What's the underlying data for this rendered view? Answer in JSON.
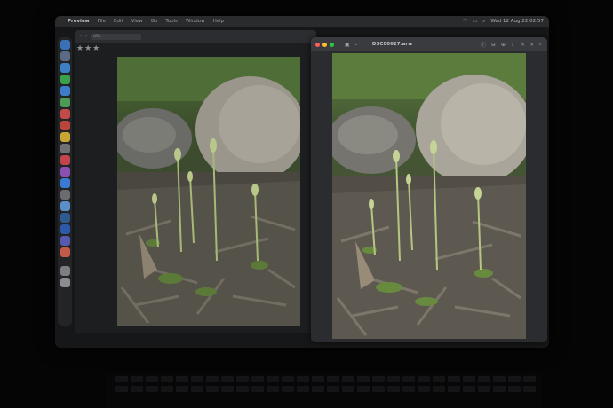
{
  "menubar": {
    "apple": "",
    "app": "Preview",
    "items": [
      "File",
      "Edit",
      "View",
      "Go",
      "Tools",
      "Window",
      "Help"
    ],
    "clock": "Wed 12 Aug 22:02:57"
  },
  "left_window": {
    "address": "URL",
    "rating": "★★★"
  },
  "right_window": {
    "title": "DSC00627.arw"
  },
  "colors": {
    "close": "#ff5f57",
    "minimize": "#febc2e",
    "maximize": "#28c840"
  },
  "icons": [
    "apple-icon",
    "wifi-icon",
    "battery-icon",
    "search-icon",
    "sidebar-icon",
    "info-icon",
    "zoom-out-icon",
    "zoom-in-icon",
    "share-icon",
    "markup-icon"
  ]
}
